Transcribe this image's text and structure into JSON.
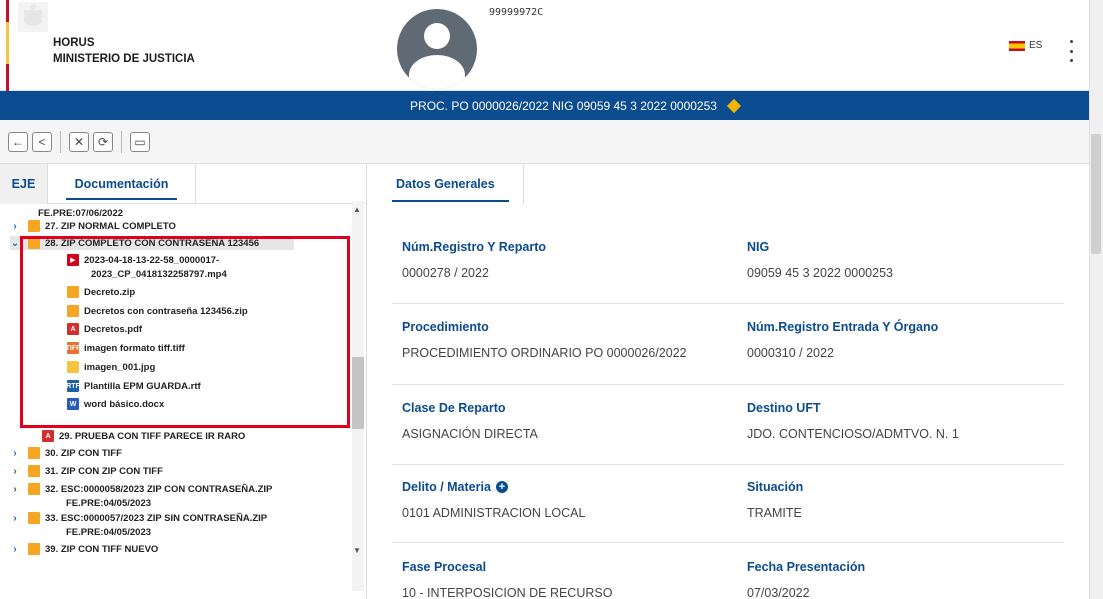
{
  "header": {
    "org_name": "HORUS",
    "ministry": "MINISTERIO DE JUSTICIA",
    "user_id": "99999972C",
    "language": "ES"
  },
  "procedure_bar": {
    "text": "PROC. PO 0000026/2022 NIG 09059 45 3 2022 0000253"
  },
  "toolbar": {
    "back": "←",
    "prev": "<",
    "close": "✕",
    "refresh": "⟳",
    "panel": "▭"
  },
  "left_tabs": {
    "eje": "EJE",
    "documentacion": "Documentación"
  },
  "tree": [
    {
      "text": "FE.PRE:07/06/2022",
      "chevron": "",
      "icon": "",
      "iconText": ""
    },
    {
      "text": "27. ZIP NORMAL COMPLETO",
      "chevron": "›",
      "icon": "i-zip",
      "iconText": ""
    },
    {
      "text": "28. ZIP COMPLETO CON CONTRASEÑA 123456",
      "chevron": "⌄",
      "icon": "i-zip",
      "iconText": ""
    },
    {
      "text": "2023-04-18-13-22-58_0000017-",
      "chevron": "",
      "icon": "i-vid",
      "iconText": "▶"
    },
    {
      "text": "2023_CP_0418132258797.mp4",
      "chevron": "",
      "icon": "",
      "iconText": ""
    },
    {
      "text": "Decreto.zip",
      "chevron": "",
      "icon": "i-zip",
      "iconText": ""
    },
    {
      "text": "Decretos con contraseña 123456.zip",
      "chevron": "",
      "icon": "i-zip",
      "iconText": ""
    },
    {
      "text": "Decretos.pdf",
      "chevron": "",
      "icon": "i-pdf",
      "iconText": "A"
    },
    {
      "text": "imagen formato tiff.tiff",
      "chevron": "",
      "icon": "i-tif",
      "iconText": "TIFF"
    },
    {
      "text": "imagen_001.jpg",
      "chevron": "",
      "icon": "i-jpg",
      "iconText": ""
    },
    {
      "text": "Plantilla EPM GUARDA.rtf",
      "chevron": "",
      "icon": "i-rtf",
      "iconText": "RTF"
    },
    {
      "text": "word básico.docx",
      "chevron": "",
      "icon": "i-doc",
      "iconText": "W"
    },
    {
      "text": "29. PRUEBA CON TIFF PARECE IR RARO",
      "chevron": "",
      "icon": "i-pdf",
      "iconText": "A"
    },
    {
      "text": "30. ZIP CON TIFF",
      "chevron": "›",
      "icon": "i-zip",
      "iconText": ""
    },
    {
      "text": "31. ZIP CON ZIP CON TIFF",
      "chevron": "›",
      "icon": "i-zip",
      "iconText": ""
    },
    {
      "text": "32. ESC:0000058/2023 ZIP CON CONTRASEÑA.ZIP",
      "chevron": "›",
      "icon": "i-zip",
      "iconText": ""
    },
    {
      "text": "FE.PRE:04/05/2023",
      "chevron": "",
      "icon": "",
      "iconText": ""
    },
    {
      "text": "33. ESC:0000057/2023 ZIP SIN CONTRASEÑA.ZIP",
      "chevron": "›",
      "icon": "i-zip",
      "iconText": ""
    },
    {
      "text": "FE.PRE:04/05/2023",
      "chevron": "",
      "icon": "",
      "iconText": ""
    },
    {
      "text": "39. ZIP CON TIFF NUEVO",
      "chevron": "›",
      "icon": "i-zip",
      "iconText": ""
    }
  ],
  "right_tab": "Datos Generales",
  "fields": {
    "num_registro_label": "Núm.Registro Y Reparto",
    "num_registro_value": "0000278 / 2022",
    "nig_label": "NIG",
    "nig_value": "09059 45 3 2022 0000253",
    "procedimiento_label": "Procedimiento",
    "procedimiento_value": "PROCEDIMIENTO ORDINARIO PO 0000026/2022",
    "num_entrada_label": "Núm.Registro Entrada Y Órgano",
    "num_entrada_value": "0000310 / 2022",
    "clase_label": "Clase De Reparto",
    "clase_value": "ASIGNACIÓN DIRECTA",
    "destino_label": "Destino UFT",
    "destino_value": "JDO. CONTENCIOSO/ADMTVO. N. 1",
    "delito_label": "Delito / Materia",
    "delito_value": "0101 ADMINISTRACION LOCAL",
    "situacion_label": "Situación",
    "situacion_value": "TRAMITE",
    "fase_label": "Fase Procesal",
    "fase_value": "10 - INTERPOSICION DE RECURSO",
    "fecha_label": "Fecha Presentación",
    "fecha_value": "07/03/2022"
  }
}
